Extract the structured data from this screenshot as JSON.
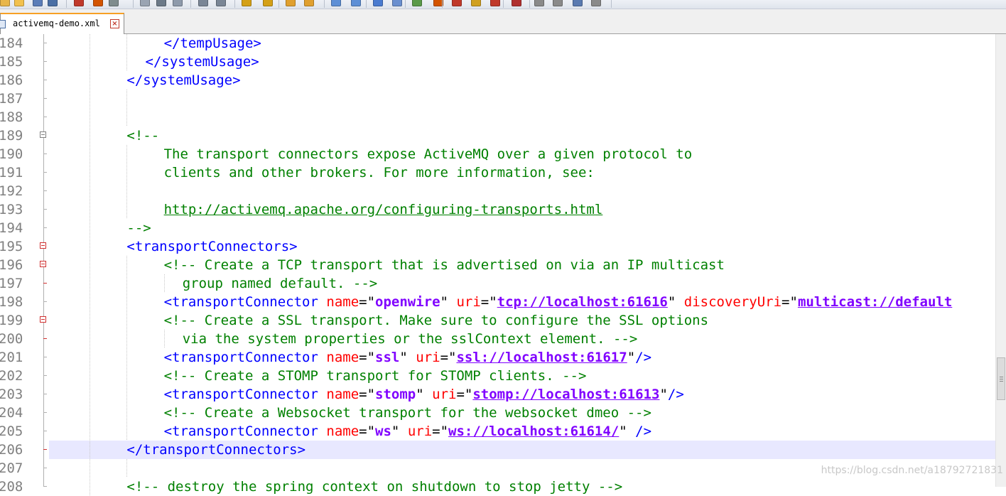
{
  "toolbar": {
    "icons": [
      "new-file-icon",
      "open-icon",
      "save-icon",
      "save-all-icon",
      "close-icon",
      "close-all-icon",
      "print-icon",
      "cut-icon",
      "copy-icon",
      "paste-icon",
      "undo-icon",
      "redo-icon",
      "find-icon",
      "replace-icon",
      "zoom-in-icon",
      "zoom-out-icon",
      "sync-v-icon",
      "sync-h-icon",
      "word-wrap-icon",
      "show-all-chars-icon",
      "indent-guide-icon",
      "lang-icon",
      "doc-map-icon",
      "function-list-icon",
      "folder-icon",
      "record-macro-icon",
      "stop-record-icon",
      "play-macro-icon",
      "run-macro-icon",
      "save-macro-icon"
    ]
  },
  "tab": {
    "label": "activemq-demo.xml",
    "close": "×"
  },
  "editor": {
    "current_line": 206,
    "lines": [
      {
        "n": "184",
        "indent": 12,
        "tokens": [
          {
            "t": "tag",
            "v": "</tempUsage>"
          }
        ]
      },
      {
        "n": "185",
        "indent": 10,
        "tokens": [
          {
            "t": "tag",
            "v": "</systemUsage>"
          }
        ]
      },
      {
        "n": "186",
        "indent": 8,
        "tokens": [
          {
            "t": "tag",
            "v": "</systemUsage>"
          }
        ]
      },
      {
        "n": "187",
        "indent": 0,
        "tokens": []
      },
      {
        "n": "188",
        "indent": 0,
        "tokens": []
      },
      {
        "n": "189",
        "indent": 8,
        "fold": "box",
        "tokens": [
          {
            "t": "cmt",
            "v": "<!--"
          }
        ]
      },
      {
        "n": "190",
        "indent": 12,
        "tokens": [
          {
            "t": "cmt",
            "v": "The transport connectors expose ActiveMQ over a given protocol to"
          }
        ]
      },
      {
        "n": "191",
        "indent": 12,
        "tokens": [
          {
            "t": "cmt",
            "v": "clients and other brokers. For more information, see:"
          }
        ]
      },
      {
        "n": "192",
        "indent": 0,
        "tokens": []
      },
      {
        "n": "193",
        "indent": 12,
        "tokens": [
          {
            "t": "cmt url",
            "v": "http://activemq.apache.org/configuring-transports.html"
          }
        ]
      },
      {
        "n": "194",
        "indent": 8,
        "fold": "end",
        "tokens": [
          {
            "t": "cmt",
            "v": "-->"
          }
        ]
      },
      {
        "n": "195",
        "indent": 8,
        "fold": "redbox",
        "tokens": [
          {
            "t": "tag",
            "v": "<transportConnectors>"
          }
        ]
      },
      {
        "n": "196",
        "indent": 12,
        "fold": "redbox",
        "tokens": [
          {
            "t": "cmt",
            "v": "<!-- Create a TCP transport that is advertised on via an IP multicast"
          }
        ]
      },
      {
        "n": "197",
        "indent": 14,
        "fold": "redend",
        "tokens": [
          {
            "t": "cmt",
            "v": "group named default. -->"
          }
        ]
      },
      {
        "n": "198",
        "indent": 12,
        "tokens": [
          {
            "t": "tag",
            "v": "<transportConnector "
          },
          {
            "t": "attr",
            "v": "name"
          },
          {
            "t": "plain",
            "v": "=\""
          },
          {
            "t": "str",
            "v": "openwire"
          },
          {
            "t": "plain",
            "v": "\" "
          },
          {
            "t": "attr",
            "v": "uri"
          },
          {
            "t": "plain",
            "v": "=\""
          },
          {
            "t": "str url",
            "v": "tcp://localhost:61616"
          },
          {
            "t": "plain",
            "v": "\" "
          },
          {
            "t": "attr",
            "v": "discoveryUri"
          },
          {
            "t": "plain",
            "v": "=\""
          },
          {
            "t": "str url",
            "v": "multicast://default"
          }
        ]
      },
      {
        "n": "199",
        "indent": 12,
        "fold": "redbox",
        "tokens": [
          {
            "t": "cmt",
            "v": "<!-- Create a SSL transport. Make sure to configure the SSL options"
          }
        ]
      },
      {
        "n": "200",
        "indent": 14,
        "fold": "redend",
        "tokens": [
          {
            "t": "cmt",
            "v": "via the system properties or the sslContext element. -->"
          }
        ]
      },
      {
        "n": "201",
        "indent": 12,
        "tokens": [
          {
            "t": "tag",
            "v": "<transportConnector "
          },
          {
            "t": "attr",
            "v": "name"
          },
          {
            "t": "plain",
            "v": "=\""
          },
          {
            "t": "str",
            "v": "ssl"
          },
          {
            "t": "plain",
            "v": "\" "
          },
          {
            "t": "attr",
            "v": "uri"
          },
          {
            "t": "plain",
            "v": "=\""
          },
          {
            "t": "str url",
            "v": "ssl://localhost:61617"
          },
          {
            "t": "plain",
            "v": "\""
          },
          {
            "t": "tag",
            "v": "/>"
          }
        ]
      },
      {
        "n": "202",
        "indent": 12,
        "tokens": [
          {
            "t": "cmt",
            "v": "<!-- Create a STOMP transport for STOMP clients. -->"
          }
        ]
      },
      {
        "n": "203",
        "indent": 12,
        "tokens": [
          {
            "t": "tag",
            "v": "<transportConnector "
          },
          {
            "t": "attr",
            "v": "name"
          },
          {
            "t": "plain",
            "v": "=\""
          },
          {
            "t": "str",
            "v": "stomp"
          },
          {
            "t": "plain",
            "v": "\" "
          },
          {
            "t": "attr",
            "v": "uri"
          },
          {
            "t": "plain",
            "v": "=\""
          },
          {
            "t": "str url",
            "v": "stomp://localhost:61613"
          },
          {
            "t": "plain",
            "v": "\""
          },
          {
            "t": "tag",
            "v": "/>"
          }
        ]
      },
      {
        "n": "204",
        "indent": 12,
        "tokens": [
          {
            "t": "cmt",
            "v": "<!-- Create a Websocket transport for the websocket dmeo -->"
          }
        ]
      },
      {
        "n": "205",
        "indent": 12,
        "tokens": [
          {
            "t": "tag",
            "v": "<transportConnector "
          },
          {
            "t": "attr",
            "v": "name"
          },
          {
            "t": "plain",
            "v": "=\""
          },
          {
            "t": "str",
            "v": "ws"
          },
          {
            "t": "plain",
            "v": "\" "
          },
          {
            "t": "attr",
            "v": "uri"
          },
          {
            "t": "plain",
            "v": "=\""
          },
          {
            "t": "str url",
            "v": "ws://localhost:61614/"
          },
          {
            "t": "plain",
            "v": "\" "
          },
          {
            "t": "tag",
            "v": "/>"
          }
        ]
      },
      {
        "n": "206",
        "indent": 8,
        "fold": "redend",
        "tokens": [
          {
            "t": "tag",
            "v": "</transportConnectors>"
          }
        ]
      },
      {
        "n": "207",
        "indent": 0,
        "tokens": []
      },
      {
        "n": "208",
        "indent": 8,
        "tokens": [
          {
            "t": "cmt",
            "v": "<!-- destroy the spring context on shutdown to stop jetty -->"
          }
        ]
      }
    ]
  },
  "watermark": "https://blog.csdn.net/a18792721831",
  "colors": {
    "tag": "#0000ff",
    "attribute": "#ff0000",
    "string": "#8000ff",
    "comment": "#008000",
    "line_number": "#808080",
    "current_line_bg": "#e8e8ff"
  }
}
